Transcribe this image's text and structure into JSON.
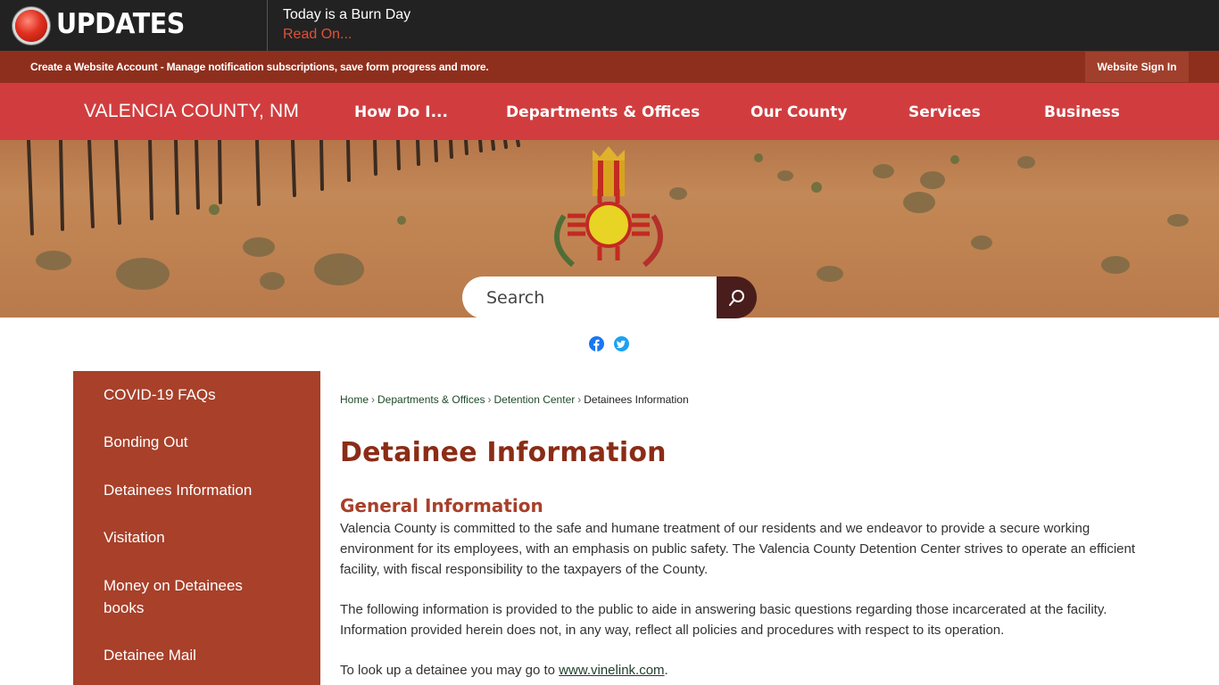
{
  "alert": {
    "title": "UPDATES",
    "message": "Today is a Burn Day",
    "link": "Read On..."
  },
  "account": {
    "text": "Create a Website Account - Manage notification subscriptions, save form progress and more.",
    "signin": "Website Sign In"
  },
  "nav": {
    "site_name": "VALENCIA COUNTY, NM",
    "items": [
      "How Do I...",
      "Departments & Offices",
      "Our County",
      "Services",
      "Business"
    ]
  },
  "search": {
    "placeholder": "Search"
  },
  "social": {
    "facebook": "facebook-icon",
    "twitter": "twitter-icon"
  },
  "sidebar": {
    "items": [
      "COVID-19 FAQs",
      "Bonding Out",
      "Detainees Information",
      "Visitation",
      "Money on Detainees books",
      "Detainee Mail"
    ]
  },
  "breadcrumb": [
    "Home",
    "Departments & Offices",
    "Detention Center",
    "Detainees Information"
  ],
  "content": {
    "title": "Detainee Information",
    "section_title": "General Information",
    "para1": "Valencia County is committed to the safe and humane treatment of our residents and we endeavor to provide a secure working environment for its employees, with an emphasis on public safety. The Valencia County Detention Center strives to operate an efficient facility, with fiscal responsibility to the taxpayers of the County.",
    "para2": "The following information is provided to the public to aide in answering basic questions regarding those incarcerated at the facility. Information provided herein does not, in any way, reflect all policies and procedures with respect to its operation.",
    "para3_prefix": "To look up a detainee you may go to ",
    "para3_link": "www.vinelink.com",
    "para3_suffix": "."
  },
  "colors": {
    "alert_bg": "#222222",
    "account_bg": "#8e2f1d",
    "nav_bg": "#d13d3f",
    "sidebar_bg": "#a8402a",
    "title": "#8b2c17"
  }
}
